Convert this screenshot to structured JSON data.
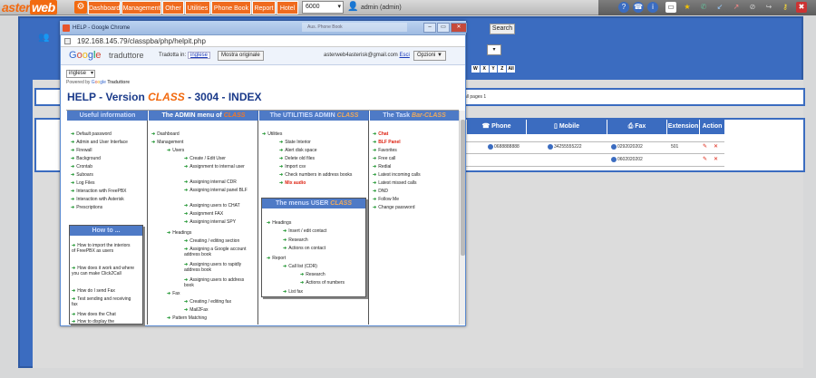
{
  "topbar": {
    "logo_a": "aster",
    "logo_b": "web",
    "nav": [
      "Dashboard",
      "Management",
      "Other",
      "Utilities",
      "Phone Book",
      "Report",
      "Hotel"
    ],
    "extension_select": "6000",
    "user_label": "admin (admin)"
  },
  "page": {
    "search_button": "Search",
    "letters": [
      "W",
      "X",
      "Y",
      "Z",
      "All"
    ],
    "pages_text": "all pages 1"
  },
  "table": {
    "headers": [
      "Phone",
      "Mobile",
      "Fax",
      "Extension",
      "Action"
    ],
    "rows": [
      {
        "phone": "0688888888",
        "mobile": "34255555222",
        "fax": "0292020202",
        "extension": "501"
      },
      {
        "phone": "",
        "mobile": "",
        "fax": "0602020202",
        "extension": ""
      }
    ]
  },
  "popup": {
    "title": "HELP - Google Chrome",
    "phone_frame": "Aus. Phone Book",
    "url": "192.168.145.79/classpba/php/helpit.php",
    "google": "Google",
    "traduttore": "traduttore",
    "tradotta_label": "Tradotta in:",
    "tradotta_lang": "inglese",
    "mostra_button": "Mostra originale",
    "email": "asterweb4asterisk@gmail.com",
    "esci": "Esci",
    "opzioni": "Opzioni ▼",
    "lang_select": "inglese",
    "powered_by": "Powered by",
    "powered_traduttore": "Traduttore",
    "help_title_a": "HELP - Version ",
    "help_title_b": "CLASS",
    "help_title_c": " - 3004 - INDEX"
  },
  "help": {
    "useful_header": "Useful information",
    "useful_items": [
      "Default password",
      "Admin and User Interface",
      "Firewall",
      "Background",
      "Crontab",
      "Suboars",
      "Log Files",
      "Interaction with FreePBX",
      "Interaction with Asterisk",
      "Prescriptions"
    ],
    "howto_header": "How to ...",
    "howto_items": [
      "How to import the interiors of FreePBX as users",
      "How does it work and where you can make Click2Call",
      "How do I send Fax",
      "Test sending and receiving fax",
      "How does the Chat",
      "How to display the"
    ],
    "admin_header_a": "The ADMIN menu of ",
    "admin_header_b": "CLASS",
    "admin_items": [
      "Dashboard",
      "Management",
      "Users",
      "Create / Edit User",
      "Assignment to internal user",
      "Assigning internal CDR",
      "Assigning internal panel BLF",
      "Assigning users to CHAT",
      "Assignment FAX",
      "Assigning internal SPY",
      "Headings",
      "Creating / editing section",
      "Assigning a Google account address book",
      "Assigning users to rapidly address book",
      "Assigning users to address book",
      "Fax",
      "Creating / editing fax",
      "Mail2Fax",
      "Pattern Matching"
    ],
    "util_header_a": "The UTILITIES ADMIN ",
    "util_header_b": "CLASS",
    "util_items": [
      "Utilities",
      "State Interior",
      "Alert disk space",
      "Delete old files",
      "Import csv",
      "Check numbers in address books",
      "Mix audio"
    ],
    "user_header_a": "The menus USER ",
    "user_header_b": "CLASS",
    "user_items": [
      "Headings",
      "Insert / edit contact",
      "Research",
      "Actions on contact",
      "Report",
      "Call list (CDR)",
      "Research",
      "Actions of numbers",
      "List fax"
    ],
    "task_header_a": "The Task ",
    "task_header_b": "Bar-CLASS",
    "task_items": [
      "Chat",
      "BLF Panel",
      "Favorites",
      "Free call",
      "Redial",
      "Latest incoming calls",
      "Latest missed calls",
      "DND",
      "Follow Me",
      "Change password"
    ]
  }
}
